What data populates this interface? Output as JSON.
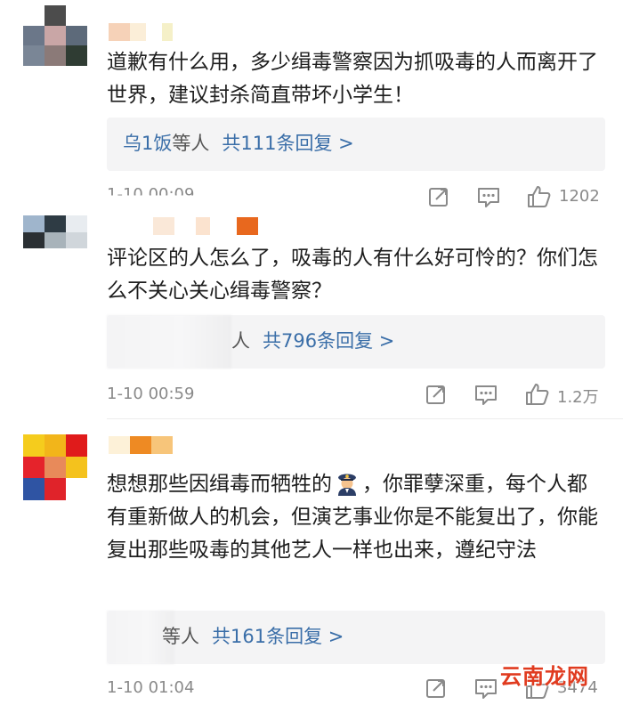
{
  "comments": [
    {
      "text": "道歉有什么用，多少缉毒警察因为抓吸毒的人而离开了世界，建议封杀简直带坏小学生！",
      "reply_who": "乌1饭",
      "reply_tail": "等人",
      "reply_count": "共111条回复 >",
      "timestamp": "1-10 00:09",
      "likes": "1202"
    },
    {
      "text": "评论区的人怎么了，吸毒的人有什么好可怜的？你们怎么不关心关心缉毒警察？",
      "reply_who": "",
      "reply_tail": "人",
      "reply_count": "共796条回复 >",
      "timestamp": "1-10 00:59",
      "likes": "1.2万"
    },
    {
      "text_before_emoji": "想想那些因缉毒而牺牲的",
      "text_after_emoji": "，你罪孽深重，每个人都有重新做人的机会，但演艺事业你是不能复出了，你能复出那些吸毒的其他艺人一样也出来，遵纪守法",
      "reply_who": "",
      "reply_tail": "等人",
      "reply_count": "共161条回复 >",
      "timestamp": "1-10 01:04",
      "likes": "3474"
    }
  ],
  "watermark": "云南龙网",
  "colors": {
    "link": "#3a6ea8",
    "meta": "#8a8a8a",
    "reply_bg": "#f4f4f5",
    "watermark": "#e03b1f"
  },
  "icons": [
    "share-icon",
    "comment-icon",
    "thumbs-up-icon",
    "police-emoji-icon"
  ]
}
